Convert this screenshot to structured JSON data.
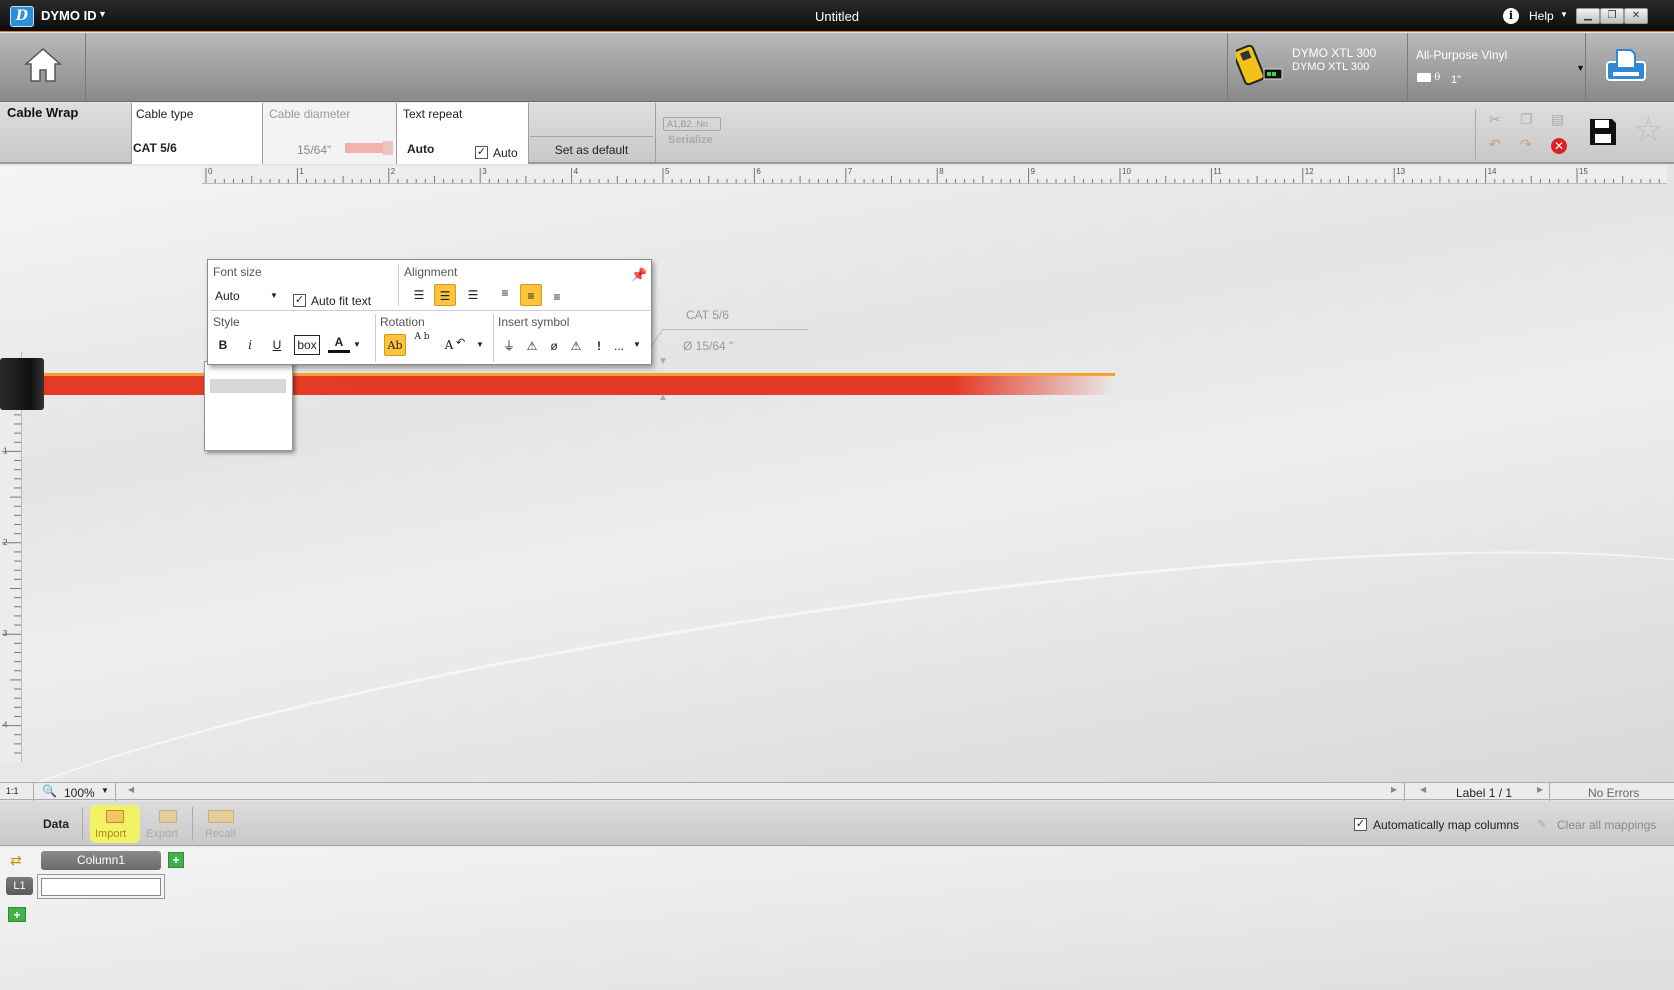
{
  "titlebar": {
    "app_name": "DYMO ID",
    "document_title": "Untitled",
    "help_label": "Help",
    "app_logo_letter": "D"
  },
  "printer": {
    "name_line1": "DYMO XTL 300",
    "name_line2": "DYMO XTL 300"
  },
  "media": {
    "name": "All-Purpose Vinyl",
    "size": "1\""
  },
  "properties": {
    "label_type": "Cable Wrap",
    "cable_type_heading": "Cable type",
    "cable_type_value": "CAT 5/6",
    "cable_diameter_heading": "Cable diameter",
    "cable_diameter_value": "15/64\"",
    "text_repeat_heading": "Text repeat",
    "text_repeat_value": "Auto",
    "text_repeat_auto_label": "Auto",
    "text_repeat_auto_checked": true,
    "set_default_label": "Set as default",
    "serialize_sample": "A1,B2..Nn",
    "serialize_label": "Serialize"
  },
  "ruler": {
    "h_labels": [
      "0",
      "1",
      "2",
      "3",
      "4",
      "5",
      "6",
      "7",
      "8",
      "9",
      "10",
      "11",
      "12",
      "13",
      "14",
      "15"
    ],
    "v_labels": [
      "1",
      "2",
      "3",
      "4"
    ]
  },
  "canvas": {
    "annotation_type": "CAT 5/6",
    "annotation_diameter": "Ø 15/64 \""
  },
  "format_panel": {
    "font_size_heading": "Font size",
    "font_size_value": "Auto",
    "auto_fit_label": "Auto fit text",
    "auto_fit_checked": true,
    "alignment_heading": "Alignment",
    "style_heading": "Style",
    "bold_label": "B",
    "italic_label": "i",
    "underline_label": "U",
    "box_label": "box",
    "font_color_label": "A",
    "rotation_heading": "Rotation",
    "rotation_horizontal_label": "Ab",
    "rotation_vertical_label": "A b",
    "rotation_rotate_label": "A",
    "insert_symbol_heading": "Insert symbol",
    "symbol_more_label": "..."
  },
  "statusbar": {
    "zoom_value": "100%",
    "label_counter": "Label 1 / 1",
    "errors_status": "No Errors"
  },
  "data_panel": {
    "title": "Data",
    "import_label": "Import",
    "export_label": "Export",
    "recall_label": "Recall",
    "auto_map_label": "Automatically map columns",
    "auto_map_checked": true,
    "clear_mappings_label": "Clear all mappings",
    "column_header": "Column1",
    "row_header": "L1",
    "row_value": ""
  },
  "colors": {
    "accent_orange": "#e07a1f",
    "cable_red": "#e43a24",
    "active_button": "#ffc43d",
    "import_highlight": "#f2f267",
    "add_green": "#3fb34a"
  }
}
